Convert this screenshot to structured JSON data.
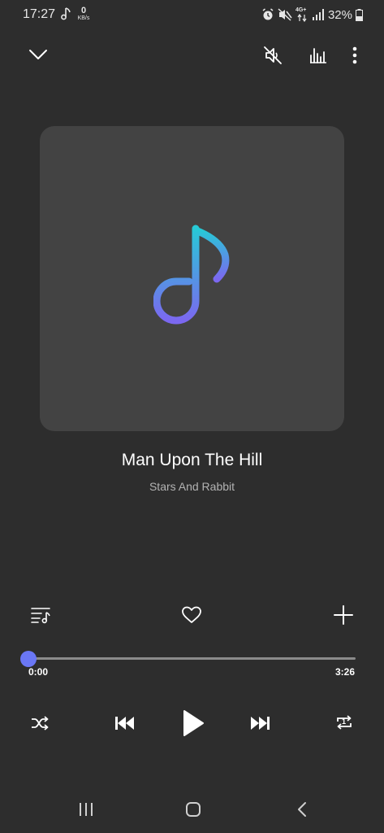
{
  "status": {
    "time": "17:27",
    "net_speed_value": "0",
    "net_speed_unit": "KB/s",
    "network_label": "4G+",
    "battery": "32%"
  },
  "topbar": {
    "collapse_icon": "chevron-down-icon",
    "mute_icon": "speaker-muted-icon",
    "equalizer_icon": "equalizer-icon",
    "more_icon": "more-vertical-icon"
  },
  "track": {
    "title": "Man Upon The Hill",
    "artist": "Stars And Rabbit",
    "current_time": "0:00",
    "total_time": "3:26",
    "progress": 0
  },
  "actions": {
    "queue_icon": "playlist-icon",
    "favorite_icon": "heart-icon",
    "add_icon": "plus-icon"
  },
  "controls": {
    "shuffle_icon": "shuffle-icon",
    "previous_icon": "skip-previous-icon",
    "play_icon": "play-icon",
    "next_icon": "skip-next-icon",
    "repeat_icon": "repeat-one-icon",
    "repeat_badge": "1"
  },
  "colors": {
    "background": "#2d2d2d",
    "album_bg": "#434343",
    "accent": "#6a77f5",
    "note_gradient_top": "#27c9d6",
    "note_gradient_bottom": "#7b68f0"
  }
}
